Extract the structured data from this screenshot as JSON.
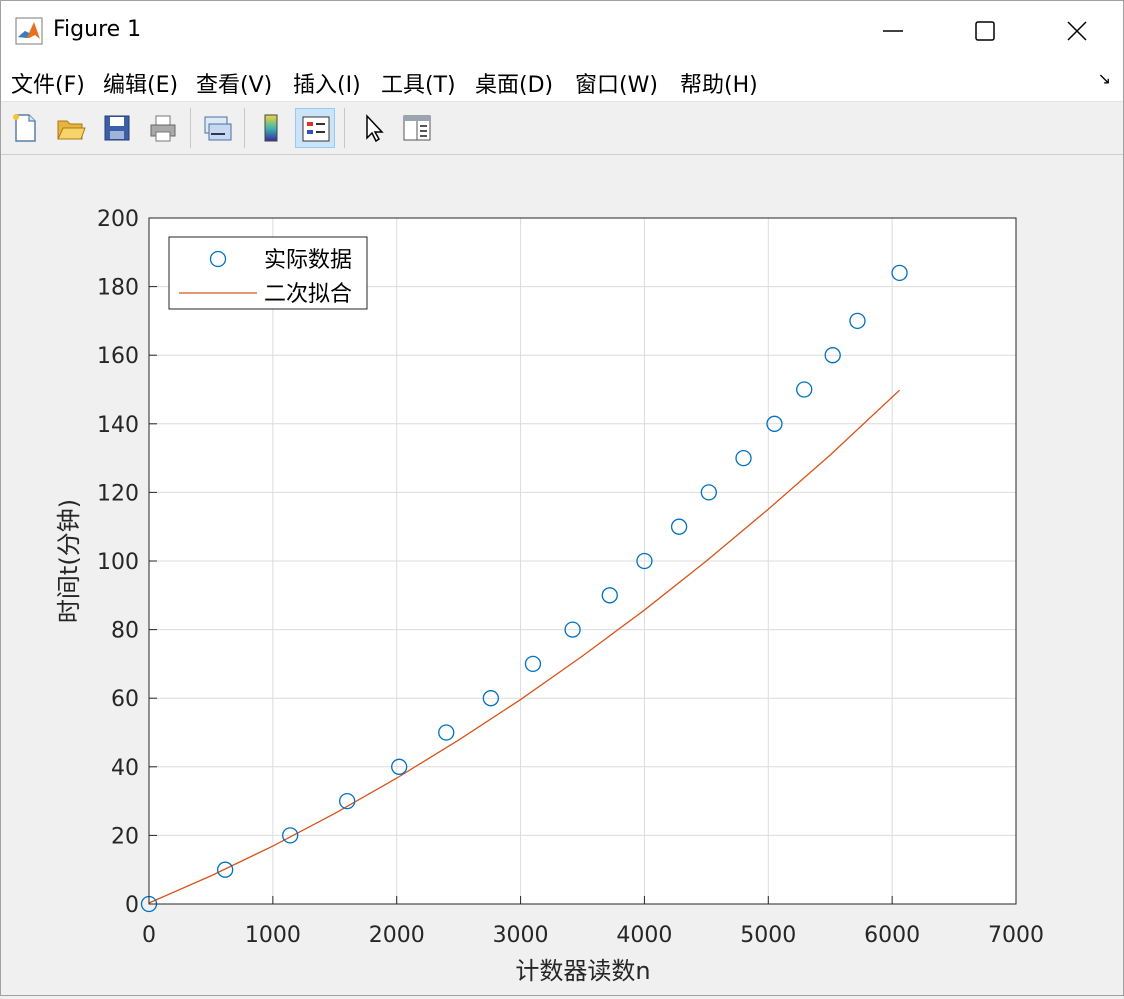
{
  "window": {
    "title": "Figure 1",
    "icons": {
      "app": "matlab-icon",
      "minimize": "minimize-icon",
      "maximize": "maximize-icon",
      "close": "close-icon"
    }
  },
  "menubar": {
    "items": [
      "文件(F)",
      "编辑(E)",
      "查看(V)",
      "插入(I)",
      "工具(T)",
      "桌面(D)",
      "窗口(W)",
      "帮助(H)"
    ],
    "dock_arrow": "↘"
  },
  "toolbar": {
    "buttons": [
      "new-figure-icon",
      "open-icon",
      "save-icon",
      "print-icon",
      "link-plot-icon",
      "insert-colorbar-icon",
      "insert-legend-icon",
      "edit-plot-icon",
      "property-inspector-icon"
    ],
    "active": "insert-legend-icon"
  },
  "chart_data": {
    "type": "scatter",
    "title": "",
    "xlabel": "计数器读数n",
    "ylabel": "时间t(分钟)",
    "xlim": [
      0,
      7000
    ],
    "ylim": [
      0,
      200
    ],
    "xticks": [
      0,
      1000,
      2000,
      3000,
      4000,
      5000,
      6000,
      7000
    ],
    "yticks": [
      0,
      20,
      40,
      60,
      80,
      100,
      120,
      140,
      160,
      180,
      200
    ],
    "grid": true,
    "legend_position": "top-left",
    "series": [
      {
        "name": "实际数据",
        "kind": "markers",
        "marker": "circle",
        "color": "#0072BD",
        "x": [
          0,
          615,
          1140,
          1600,
          2020,
          2400,
          2760,
          3100,
          3420,
          3720,
          4000,
          4280,
          4520,
          4800,
          5050,
          5290,
          5520,
          5720,
          6060
        ],
        "y": [
          0,
          10,
          20,
          30,
          40,
          50,
          60,
          70,
          80,
          90,
          100,
          110,
          120,
          130,
          140,
          150,
          160,
          170,
          184
        ]
      },
      {
        "name": "二次拟合",
        "kind": "line",
        "color": "#D95319",
        "x": [
          0,
          500,
          1000,
          1500,
          2000,
          2500,
          3000,
          3500,
          4000,
          4500,
          5000,
          5500,
          6060
        ],
        "y": [
          0.3,
          8.2,
          16.9,
          26.4,
          36.7,
          47.8,
          59.6,
          72.3,
          85.7,
          100.0,
          115.1,
          130.9,
          149.8
        ]
      }
    ]
  }
}
